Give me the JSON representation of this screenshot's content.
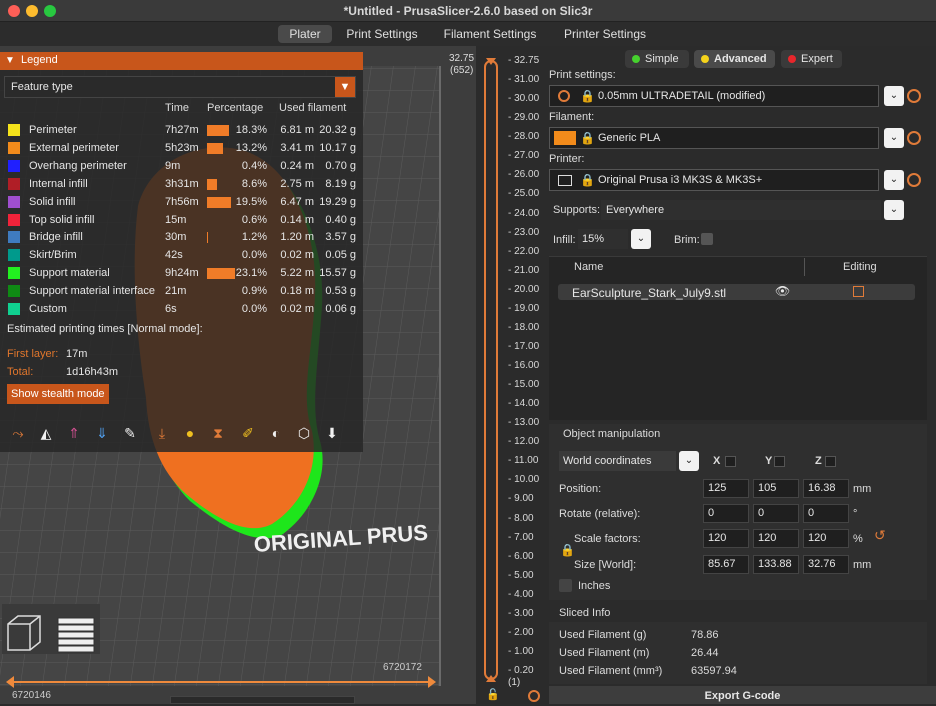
{
  "window": {
    "title": "*Untitled - PrusaSlicer-2.6.0 based on Slic3r",
    "traffic_lights": [
      "#fe5f57",
      "#febc2e",
      "#28c840"
    ]
  },
  "tabs": [
    "Plater",
    "Print Settings",
    "Filament Settings",
    "Printer Settings"
  ],
  "legend": {
    "title": "Legend",
    "view_type": "Feature type",
    "columns": {
      "time": "Time",
      "percentage": "Percentage",
      "used": "Used filament"
    },
    "rows": [
      {
        "name": "Perimeter",
        "color": "#f5e31b",
        "time": "7h27m",
        "pct": "18.3%",
        "pct_value": 18.3,
        "m": "6.81 m",
        "g": "20.32 g"
      },
      {
        "name": "External perimeter",
        "color": "#f28b1b",
        "time": "5h23m",
        "pct": "13.2%",
        "pct_value": 13.2,
        "m": "3.41 m",
        "g": "10.17 g"
      },
      {
        "name": "Overhang perimeter",
        "color": "#2020ff",
        "time": "9m",
        "pct": "0.4%",
        "pct_value": 0.4,
        "m": "0.24 m",
        "g": "0.70 g"
      },
      {
        "name": "Internal infill",
        "color": "#b01e26",
        "time": "3h31m",
        "pct": "8.6%",
        "pct_value": 8.6,
        "m": "2.75 m",
        "g": "8.19 g"
      },
      {
        "name": "Solid infill",
        "color": "#a04fcf",
        "time": "7h56m",
        "pct": "19.5%",
        "pct_value": 19.5,
        "m": "6.47 m",
        "g": "19.29 g"
      },
      {
        "name": "Top solid infill",
        "color": "#f0233a",
        "time": "15m",
        "pct": "0.6%",
        "pct_value": 0.6,
        "m": "0.14 m",
        "g": "0.40 g"
      },
      {
        "name": "Bridge infill",
        "color": "#3f7bbf",
        "time": "30m",
        "pct": "1.2%",
        "pct_value": 1.2,
        "m": "1.20 m",
        "g": "3.57 g"
      },
      {
        "name": "Skirt/Brim",
        "color": "#009a8c",
        "time": "42s",
        "pct": "0.0%",
        "pct_value": 0.0,
        "m": "0.02 m",
        "g": "0.05 g"
      },
      {
        "name": "Support material",
        "color": "#22f020",
        "time": "9h24m",
        "pct": "23.1%",
        "pct_value": 23.1,
        "m": "5.22 m",
        "g": "15.57 g"
      },
      {
        "name": "Support material interface",
        "color": "#0f8a14",
        "time": "21m",
        "pct": "0.9%",
        "pct_value": 0.9,
        "m": "0.18 m",
        "g": "0.53 g"
      },
      {
        "name": "Custom",
        "color": "#10d090",
        "time": "6s",
        "pct": "0.0%",
        "pct_value": 0.0,
        "m": "0.02 m",
        "g": "0.06 g"
      }
    ],
    "est_title": "Estimated printing times [Normal mode]:",
    "first_layer_label": "First layer:",
    "first_layer_value": "17m",
    "total_label": "Total:",
    "total_value": "1d16h43m",
    "stealth_button": "Show stealth mode"
  },
  "bed_label": "ORIGINAL PRUS",
  "hslider": {
    "left_value": "6720146",
    "right_value": "6720172"
  },
  "vslider": {
    "top_value": "32.75",
    "top_layer": "(652)",
    "bottom_value": "0.20",
    "bottom_layer": "(1)",
    "ticks": [
      "32.75",
      "31.00",
      "30.00",
      "29.00",
      "28.00",
      "27.00",
      "26.00",
      "25.00",
      "24.00",
      "23.00",
      "22.00",
      "21.00",
      "20.00",
      "19.00",
      "18.00",
      "17.00",
      "16.00",
      "15.00",
      "14.00",
      "13.00",
      "12.00",
      "11.00",
      "10.00",
      "9.00",
      "8.00",
      "7.00",
      "6.00",
      "5.00",
      "4.00",
      "3.00",
      "2.00",
      "1.00",
      "0.20"
    ]
  },
  "modes": [
    {
      "label": "Simple",
      "color": "#46d12e"
    },
    {
      "label": "Advanced",
      "color": "#f5d31b"
    },
    {
      "label": "Expert",
      "color": "#e8262b"
    }
  ],
  "print_settings": {
    "label": "Print settings:",
    "value": "0.05mm ULTRADETAIL (modified)"
  },
  "filament": {
    "label": "Filament:",
    "value": "Generic PLA",
    "color": "#f28b1b"
  },
  "printer": {
    "label": "Printer:",
    "value": "Original Prusa i3 MK3S & MK3S+"
  },
  "supports": {
    "label": "Supports:",
    "value": "Everywhere"
  },
  "infill": {
    "label": "Infill:",
    "value": "15%"
  },
  "brim": {
    "label": "Brim:"
  },
  "objects": {
    "name_header": "Name",
    "editing_header": "Editing",
    "items": [
      {
        "name": "EarSculpture_Stark_July9.stl"
      }
    ]
  },
  "manip": {
    "title": "Object manipulation",
    "coords": "World coordinates",
    "axes": [
      "X",
      "Y",
      "Z"
    ],
    "position_label": "Position:",
    "position": [
      "125",
      "105",
      "16.38"
    ],
    "position_unit": "mm",
    "rotate_label": "Rotate (relative):",
    "rotate": [
      "0",
      "0",
      "0"
    ],
    "rotate_unit": "°",
    "scale_label": "Scale factors:",
    "scale": [
      "120",
      "120",
      "120"
    ],
    "scale_unit": "%",
    "size_label": "Size [World]:",
    "size": [
      "85.67",
      "133.88",
      "32.76"
    ],
    "size_unit": "mm",
    "inches_label": "Inches"
  },
  "sliced": {
    "title": "Sliced Info",
    "rows": [
      {
        "label": "Used Filament (g)",
        "value": "78.86"
      },
      {
        "label": "Used Filament (m)",
        "value": "26.44"
      },
      {
        "label": "Used Filament (mm³)",
        "value": "63597.94"
      }
    ]
  },
  "export_button": "Export G-code"
}
